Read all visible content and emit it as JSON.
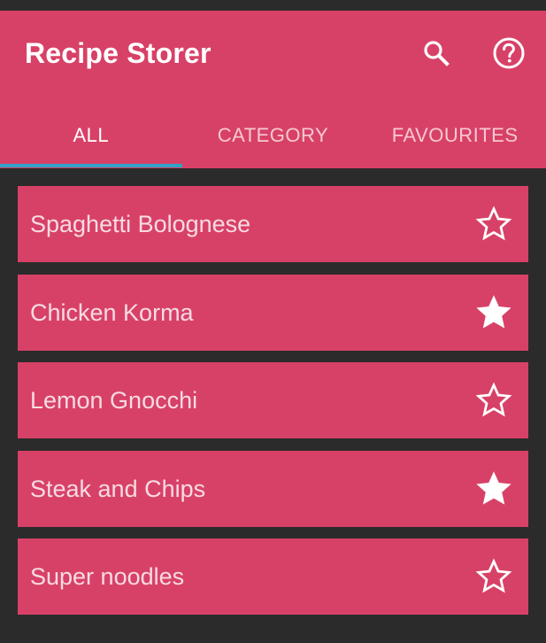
{
  "app": {
    "title": "Recipe Storer",
    "accent_color": "#d84167",
    "indicator_color": "#2fa4c6",
    "background_color": "#2b2b2b"
  },
  "toolbar": {
    "search_icon": "search-icon",
    "help_icon": "help-circle-icon"
  },
  "tabs": [
    {
      "label": "ALL",
      "selected": true
    },
    {
      "label": "CATEGORY",
      "selected": false
    },
    {
      "label": "FAVOURITES",
      "selected": false
    }
  ],
  "recipes": [
    {
      "name": "Spaghetti Bolognese",
      "favourite": false
    },
    {
      "name": "Chicken Korma",
      "favourite": true
    },
    {
      "name": "Lemon Gnocchi",
      "favourite": false
    },
    {
      "name": "Steak and Chips",
      "favourite": true
    },
    {
      "name": "Super noodles",
      "favourite": false
    }
  ]
}
